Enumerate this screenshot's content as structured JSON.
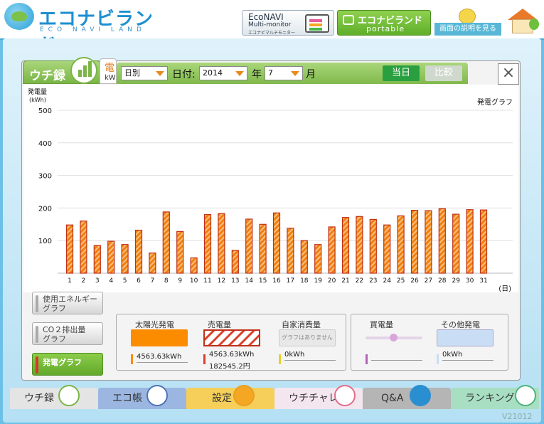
{
  "header": {
    "logo_title": "エコナビランド",
    "logo_sub": "ECO NAVI LAND",
    "econavi_line1": "EcoNAVI",
    "econavi_line2": "Multi-monitor",
    "econavi_line3": "エコナビマルチモニター",
    "portable_line1": "エコナビランド",
    "portable_line2": "portable",
    "help_label": "画面の説明を見る"
  },
  "tabs": {
    "uchiroku": "ウチ録",
    "denki_char": "電",
    "denki_unit": "kW"
  },
  "toolbar": {
    "period": "日別",
    "date_label": "日付:",
    "year": "2014",
    "year_label": "年",
    "month": "7",
    "month_label": "月",
    "today": "当日",
    "compare": "比較",
    "close": "×"
  },
  "chart_data": {
    "type": "bar",
    "title": "発電グラフ",
    "ylabel": "発電量",
    "yunit": "(kWh)",
    "xlabel": "(日)",
    "ylim": [
      0,
      500
    ],
    "yticks": [
      100,
      200,
      300,
      400,
      500
    ],
    "categories": [
      "1",
      "2",
      "3",
      "4",
      "5",
      "6",
      "7",
      "8",
      "9",
      "10",
      "11",
      "12",
      "13",
      "14",
      "15",
      "16",
      "17",
      "18",
      "19",
      "20",
      "21",
      "22",
      "23",
      "24",
      "25",
      "26",
      "27",
      "28",
      "29",
      "30",
      "31"
    ],
    "values": [
      148,
      160,
      85,
      98,
      88,
      132,
      62,
      188,
      128,
      47,
      180,
      183,
      70,
      166,
      150,
      185,
      138,
      100,
      88,
      142,
      171,
      174,
      165,
      148,
      176,
      193,
      192,
      198,
      181,
      195,
      194
    ],
    "colors": {
      "fill": "#f08010",
      "stripe": "#f8c080",
      "stroke": "#c03018",
      "grid": "#e0e0e0"
    }
  },
  "side_buttons": {
    "energy": [
      "使用エネルギー",
      "グラフ"
    ],
    "co2": [
      "CO２排出量",
      "グラフ"
    ],
    "generation": "発電グラフ"
  },
  "legend": {
    "solar": {
      "title": "太陽光発電",
      "value": "4563.63kWh",
      "color": "#fb8c00"
    },
    "sold": {
      "title": "売電量",
      "value": "4563.63kWh",
      "value2": "182545.2円",
      "color": "#d9402a"
    },
    "self": {
      "title": "自家消費量",
      "value": "0kWh",
      "note": "グラフはありません",
      "color": "#e8d22a"
    },
    "bought": {
      "title": "買電量",
      "value": "",
      "color": "#b364b8"
    },
    "other": {
      "title": "その他発電",
      "value": "0kWh",
      "color": "#c9ddf5"
    }
  },
  "nav": {
    "uchiroku": "ウチ録",
    "ecocho": "エコ帳",
    "settings": "設定",
    "uchichare": "ウチチャレ",
    "qa": "Q&A",
    "ranking": "ランキング"
  },
  "version": "V21012"
}
